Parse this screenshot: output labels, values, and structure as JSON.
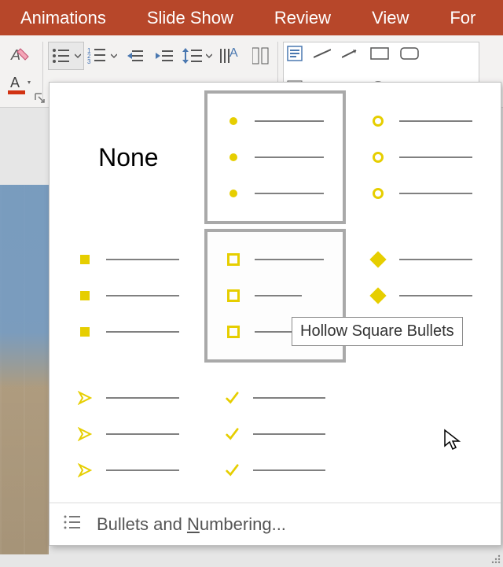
{
  "ribbon": {
    "tabs": [
      "Animations",
      "Slide Show",
      "Review",
      "View",
      "For"
    ]
  },
  "bullet_panel": {
    "none_label": "None",
    "tooltip": "Hollow Square Bullets",
    "footer_label_pre": "Bullets and ",
    "footer_label_accel": "N",
    "footer_label_post": "umbering...",
    "options": [
      {
        "id": "none"
      },
      {
        "id": "filled-round",
        "selected": true
      },
      {
        "id": "hollow-round"
      },
      {
        "id": "filled-square"
      },
      {
        "id": "hollow-square",
        "hover": true
      },
      {
        "id": "four-diamond"
      },
      {
        "id": "arrow"
      },
      {
        "id": "checkmark"
      }
    ]
  }
}
